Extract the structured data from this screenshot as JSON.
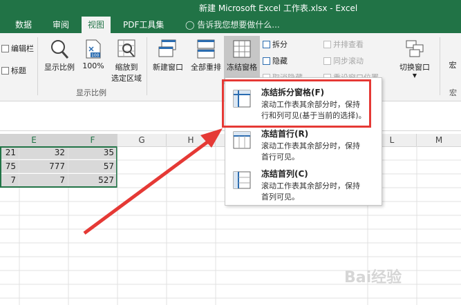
{
  "window": {
    "title": "新建 Microsoft Excel 工作表.xlsx - Excel"
  },
  "tabs": [
    {
      "label": "数据",
      "active": false
    },
    {
      "label": "审阅",
      "active": false
    },
    {
      "label": "视图",
      "active": true
    },
    {
      "label": "PDF工具集",
      "active": false
    }
  ],
  "tell_me": {
    "text": "告诉我您想要做什么..."
  },
  "ribbon": {
    "show_group": {
      "items": [
        {
          "label": "编辑栏"
        },
        {
          "label": "标题"
        }
      ]
    },
    "zoom_group": {
      "label": "显示比例",
      "buttons": [
        {
          "label": "显示比例"
        },
        {
          "label": "100%",
          "icon_text": "100"
        },
        {
          "label_line1": "缩放到",
          "label_line2": "选定区域"
        }
      ]
    },
    "window_group": {
      "big_buttons": [
        {
          "label": "新建窗口"
        },
        {
          "label": "全部重排"
        },
        {
          "label": "冻结窗格"
        }
      ],
      "small_buttons": [
        {
          "label": "拆分",
          "disabled": false
        },
        {
          "label": "隐藏",
          "disabled": false
        },
        {
          "label": "取消隐藏",
          "disabled": true
        },
        {
          "label": "并排查看",
          "disabled": true
        },
        {
          "label": "同步滚动",
          "disabled": true
        },
        {
          "label": "重设窗口位置",
          "disabled": true
        }
      ],
      "switch_window": {
        "label": "切换窗口"
      },
      "macro": {
        "label": "宏",
        "group_label": "宏"
      }
    }
  },
  "grid": {
    "columns": [
      {
        "name": "E",
        "selected": true
      },
      {
        "name": "F",
        "selected": true
      },
      {
        "name": "G",
        "selected": false
      },
      {
        "name": "H",
        "selected": false
      },
      {
        "name": "L",
        "selected": false
      },
      {
        "name": "M",
        "selected": false
      }
    ],
    "rows": [
      [
        "21",
        "32",
        "35"
      ],
      [
        "75",
        "777",
        "57"
      ],
      [
        "7",
        "7",
        "527"
      ]
    ]
  },
  "freeze_menu": {
    "items": [
      {
        "title": "冻结拆分窗格(F)",
        "desc_line1": "滚动工作表其余部分时，保持",
        "desc_line2": "行和列可见(基于当前的选择)。"
      },
      {
        "title": "冻结首行(R)",
        "desc_line1": "滚动工作表其余部分时，保持",
        "desc_line2": "首行可见。"
      },
      {
        "title": "冻结首列(C)",
        "desc_line1": "滚动工作表其余部分时，保持",
        "desc_line2": "首列可见。"
      }
    ]
  },
  "colors": {
    "excel_green": "#217346",
    "highlight_red": "#e53935"
  }
}
